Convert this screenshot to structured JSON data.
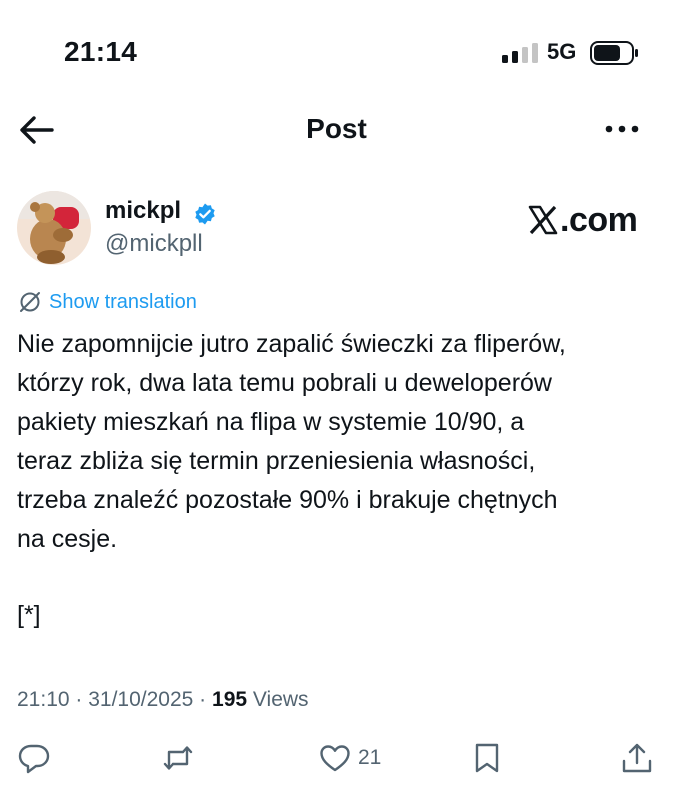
{
  "status_bar": {
    "time": "21:14",
    "network": "5G"
  },
  "header": {
    "title": "Post"
  },
  "author": {
    "display_name": "mickpl",
    "handle": "@mickpll"
  },
  "watermark": {
    "domain_text": ".com"
  },
  "translate": {
    "label": "Show translation"
  },
  "post": {
    "text": "Nie zapomnijcie jutro zapalić świeczki za fliperów,\nktórzy rok, dwa lata temu pobrali u deweloperów\npakiety mieszkań na flipa w systemie 10/90, a\nteraz zbliża się termin przeniesienia własności,\ntrzeba znaleźć pozostałe 90% i brakuje chętnych\nna cesje.",
    "footnote": "[*]"
  },
  "meta": {
    "time": "21:10",
    "separator": " · ",
    "date": "31/10/2025",
    "views_count": "195",
    "views_label": "Views"
  },
  "actions": {
    "like_count": "21"
  },
  "colors": {
    "accent": "#1d9bf0",
    "text": "#0f1419",
    "secondary": "#536471"
  },
  "icons": [
    "back-arrow-icon",
    "more-icon",
    "verified-badge-icon",
    "x-logo-icon",
    "translate-icon",
    "reply-icon",
    "repost-icon",
    "like-icon",
    "bookmark-icon",
    "share-icon",
    "signal-icon",
    "battery-icon"
  ]
}
